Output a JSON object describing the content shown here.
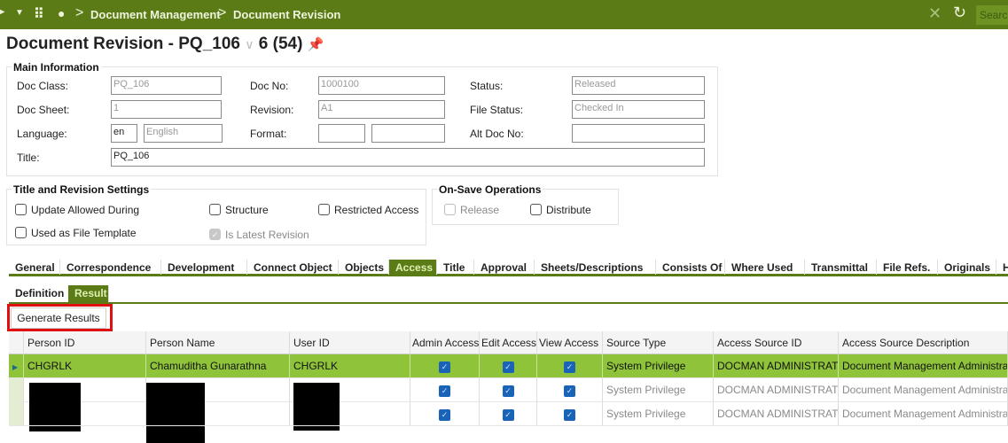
{
  "topbar": {
    "breadcrumb": [
      "Document Management",
      "Document Revision"
    ],
    "search_placeholder": "Search"
  },
  "header": {
    "title": "Document Revision - PQ_106",
    "counter": "6 (54)"
  },
  "main_info": {
    "legend": "Main Information",
    "doc_class_label": "Doc Class:",
    "doc_class": "PQ_106",
    "doc_no_label": "Doc No:",
    "doc_no": "1000100",
    "status_label": "Status:",
    "status": "Released",
    "doc_sheet_label": "Doc Sheet:",
    "doc_sheet": "1",
    "revision_label": "Revision:",
    "revision": "A1",
    "file_status_label": "File Status:",
    "file_status": "Checked In",
    "language_label": "Language:",
    "language_code": "en",
    "language": "English",
    "format_label": "Format:",
    "format1": "",
    "format2": "",
    "alt_doc_no_label": "Alt Doc No:",
    "alt_doc_no": "",
    "title_label": "Title:",
    "title": "PQ_106"
  },
  "settings": {
    "legend": "Title and Revision Settings",
    "update_allowed": "Update Allowed During",
    "structure": "Structure",
    "restricted": "Restricted Access",
    "file_template": "Used as File Template",
    "latest": "Is Latest Revision"
  },
  "onsave": {
    "legend": "On-Save Operations",
    "release": "Release",
    "distribute": "Distribute"
  },
  "tabs": [
    "General",
    "Correspondence",
    "Development",
    "Connect Object",
    "Objects",
    "Access",
    "Title",
    "Approval",
    "Sheets/Descriptions",
    "Consists Of",
    "Where Used",
    "Transmittal",
    "File Refs.",
    "Originals",
    "Hi"
  ],
  "subtabs": [
    "Definition",
    "Result"
  ],
  "generate_button": "Generate Results",
  "table": {
    "columns": [
      "Person ID",
      "Person Name",
      "User ID",
      "Admin Access",
      "Edit Access",
      "View Access",
      "Source Type",
      "Access Source ID",
      "Access Source Description"
    ],
    "rows": [
      {
        "person_id": "CHGRLK",
        "person_name": "Chamuditha Gunarathna",
        "user_id": "CHGRLK",
        "admin": true,
        "edit": true,
        "view": true,
        "source_type": "System Privilege",
        "source_id": "DOCMAN ADMINISTRATOR",
        "source_desc": "Document Management Administrator"
      },
      {
        "person_id": "",
        "person_name": "",
        "user_id": "",
        "admin": true,
        "edit": true,
        "view": true,
        "source_type": "System Privilege",
        "source_id": "DOCMAN ADMINISTRATOR",
        "source_desc": "Document Management Administrator"
      },
      {
        "person_id": "",
        "person_name": "",
        "user_id": "",
        "admin": true,
        "edit": true,
        "view": true,
        "source_type": "System Privilege",
        "source_id": "DOCMAN ADMINISTRATOR",
        "source_desc": "Document Management Administrator"
      }
    ]
  },
  "colors": {
    "brand": "#5b7b17",
    "selected_row": "#8fc43a",
    "highlight": "#e01010",
    "checkbox": "#1a64b8"
  }
}
